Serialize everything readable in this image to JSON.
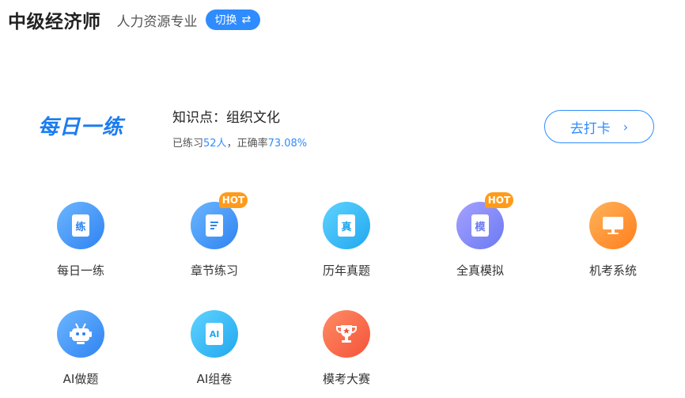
{
  "header": {
    "title": "中级经济师",
    "subject": "人力资源专业",
    "switch_label": "切换"
  },
  "daily": {
    "logo_text": "每日一练",
    "topic_label": "知识点：",
    "topic": "组织文化",
    "stats_prefix": "已练习",
    "practiced": "52人",
    "stats_mid": "，正确率",
    "accuracy": "73.08%",
    "button_label": "去打卡"
  },
  "tiles": [
    {
      "label": "每日一练",
      "glyph": "练",
      "hot": false,
      "icon": "practice-doc-icon"
    },
    {
      "label": "章节练习",
      "glyph": "",
      "hot": true,
      "hot_label": "HOT",
      "icon": "chapter-doc-icon"
    },
    {
      "label": "历年真题",
      "glyph": "真",
      "hot": false,
      "icon": "past-papers-doc-icon"
    },
    {
      "label": "全真模拟",
      "glyph": "模",
      "hot": true,
      "hot_label": "HOT",
      "icon": "mock-exam-doc-icon"
    },
    {
      "label": "机考系统",
      "glyph": "",
      "hot": false,
      "icon": "computer-exam-monitor-icon"
    },
    {
      "label": "AI做题",
      "glyph": "",
      "hot": false,
      "icon": "robot-icon"
    },
    {
      "label": "AI组卷",
      "glyph": "AI",
      "hot": false,
      "icon": "ai-doc-icon"
    },
    {
      "label": "模考大赛",
      "glyph": "",
      "hot": false,
      "icon": "trophy-icon"
    }
  ],
  "colors": {
    "accent": "#2f8cff",
    "hot_badge": "#ff9b1a"
  }
}
